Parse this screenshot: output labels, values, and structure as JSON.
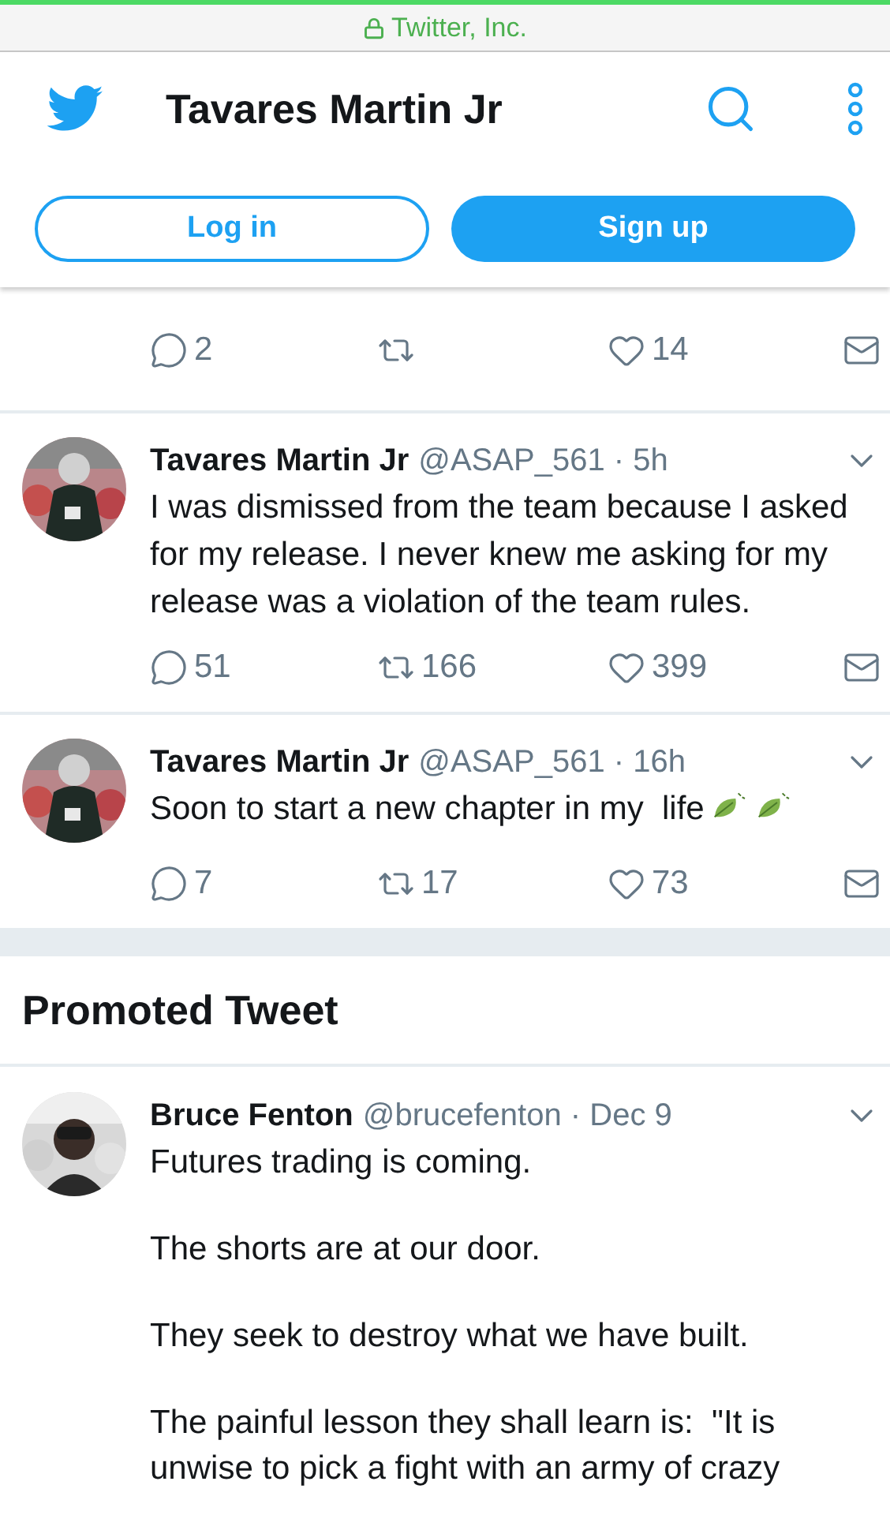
{
  "browser_bar": {
    "site": "Twitter, Inc."
  },
  "header": {
    "title": "Tavares Martin Jr",
    "login": "Log in",
    "signup": "Sign up"
  },
  "tweets": [
    {
      "replies": "2",
      "likes": "14"
    },
    {
      "author": "Tavares Martin Jr",
      "handle": "@ASAP_561",
      "time": "· 5h",
      "paragraphs": [
        "I was dismissed from the team because I asked for my release. I never knew me asking for my release was a violation of the team rules."
      ],
      "replies": "51",
      "retweets": "166",
      "likes": "399"
    },
    {
      "author": "Tavares Martin Jr",
      "handle": "@ASAP_561",
      "time": "· 16h",
      "paragraphs": [
        "Soon to start a new chapter in my  life"
      ],
      "emojis": [
        {
          "kind": "leaf"
        },
        {
          "kind": "leaf"
        }
      ],
      "replies": "7",
      "retweets": "17",
      "likes": "73"
    }
  ],
  "promoted": {
    "heading": "Promoted Tweet",
    "author": "Bruce Fenton",
    "handle": "@brucefenton",
    "time": "· Dec 9",
    "paragraphs": [
      "Futures trading is coming.",
      "The shorts are at our door.",
      "They seek to destroy what we have built.",
      "The painful lesson they shall learn is:  \"It is unwise to pick a fight with an army of crazy"
    ]
  }
}
